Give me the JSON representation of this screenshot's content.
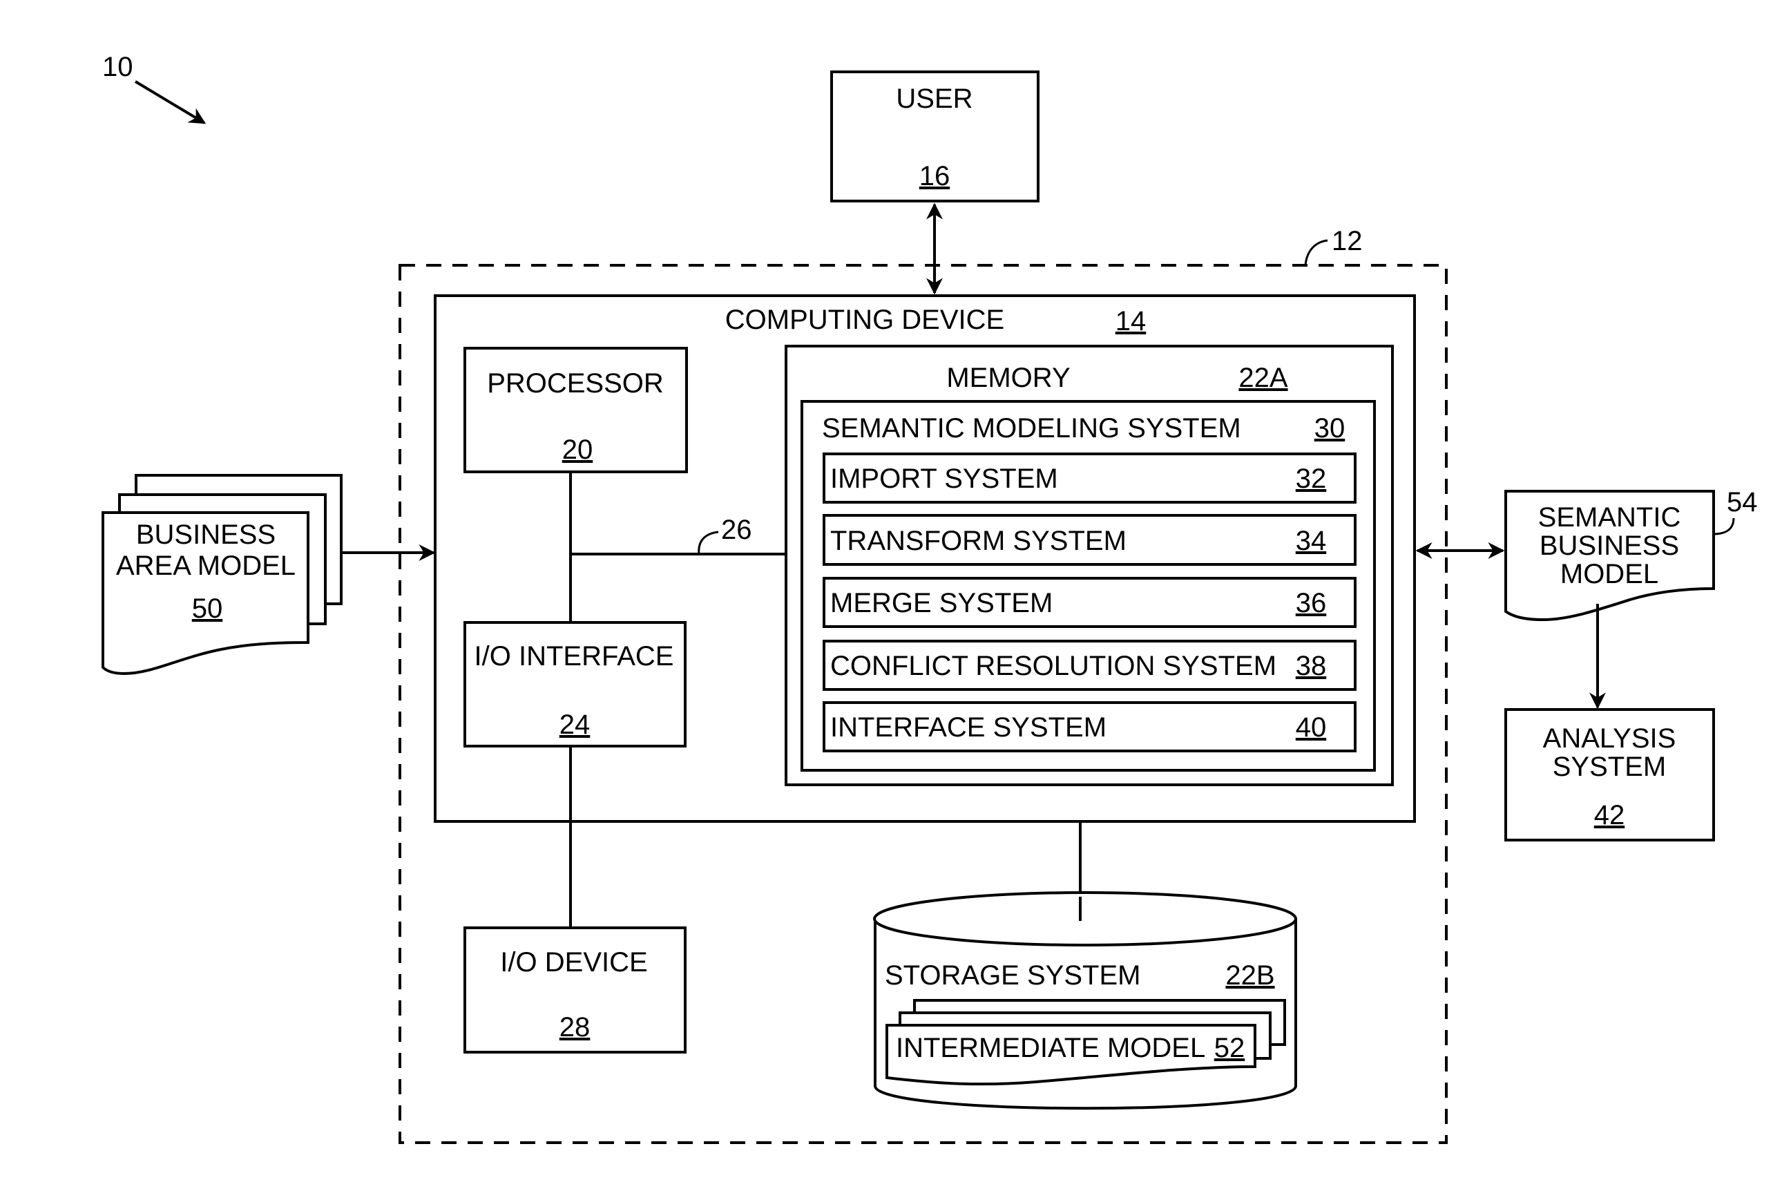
{
  "figure": {
    "ref": "10"
  },
  "environment": {
    "ref": "12"
  },
  "user": {
    "label": "USER",
    "ref": "16"
  },
  "computing_device": {
    "label": "COMPUTING DEVICE",
    "ref": "14",
    "processor": {
      "label": "PROCESSOR",
      "ref": "20"
    },
    "io_interface": {
      "label": "I/O INTERFACE",
      "ref": "24"
    },
    "bus": {
      "ref": "26"
    },
    "memory": {
      "label": "MEMORY",
      "ref": "22A",
      "semantic_modeling_system": {
        "label": "SEMANTIC MODELING SYSTEM",
        "ref": "30",
        "subsystems": [
          {
            "label": "IMPORT SYSTEM",
            "ref": "32"
          },
          {
            "label": "TRANSFORM SYSTEM",
            "ref": "34"
          },
          {
            "label": "MERGE SYSTEM",
            "ref": "36"
          },
          {
            "label": "CONFLICT RESOLUTION SYSTEM",
            "ref": "38"
          },
          {
            "label": "INTERFACE SYSTEM",
            "ref": "40"
          }
        ]
      }
    }
  },
  "io_device": {
    "label": "I/O DEVICE",
    "ref": "28"
  },
  "storage_system": {
    "label": "STORAGE SYSTEM",
    "ref": "22B",
    "intermediate_model": {
      "label": "INTERMEDIATE MODEL",
      "ref": "52"
    }
  },
  "business_area_model": {
    "lines": [
      "BUSINESS",
      "AREA MODEL"
    ],
    "ref": "50"
  },
  "semantic_business_model": {
    "lines": [
      "SEMANTIC",
      "BUSINESS",
      "MODEL"
    ],
    "ref": "54"
  },
  "analysis_system": {
    "lines": [
      "ANALYSIS",
      "SYSTEM"
    ],
    "ref": "42"
  }
}
